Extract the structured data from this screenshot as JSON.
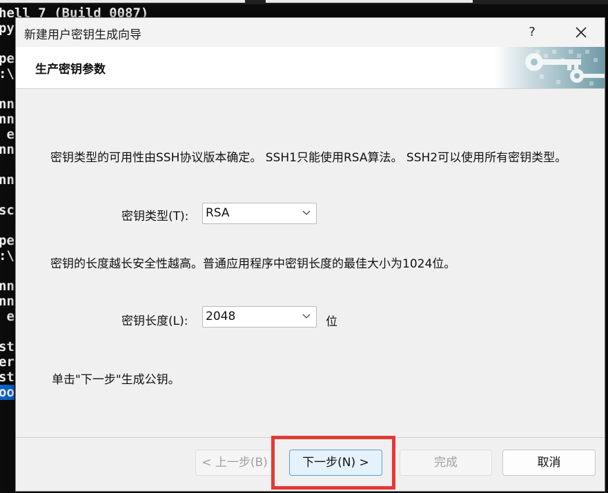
{
  "terminal": {
    "lines": [
      "hell 7 (Build 0087)",
      "py",
      "",
      "pe",
      ":\\",
      "",
      "nn",
      "nn",
      " e",
      "nn",
      "",
      "nn",
      "",
      "sc",
      "",
      "pe",
      ":\\",
      "",
      "nn",
      "nn",
      " e",
      "",
      "st",
      "er",
      "st",
      "oo"
    ]
  },
  "dialog": {
    "title": "新建用户密钥生成向导",
    "help_label": "?",
    "header_title": "生产密钥参数",
    "intro_text": "密钥类型的可用性由SSH协议版本确定。 SSH1只能使用RSA算法。 SSH2可以使用所有密钥类型。",
    "key_type_label": "密钥类型(T):",
    "key_type_value": "RSA",
    "length_note": "密钥的长度越长安全性越高。普通应用程序中密钥长度的最佳大小为1024位。",
    "key_length_label": "密钥长度(L):",
    "key_length_value": "2048",
    "key_length_unit": "位",
    "instruction": "单击\"下一步\"生成公钥。",
    "buttons": {
      "back": "< 上一步(B)",
      "next": "下一步(N) >",
      "finish": "完成",
      "cancel": "取消"
    }
  },
  "colors": {
    "highlight": "#e53935",
    "primary_button_border": "#5b9bd5",
    "terminal_selection": "#0a64c8"
  }
}
